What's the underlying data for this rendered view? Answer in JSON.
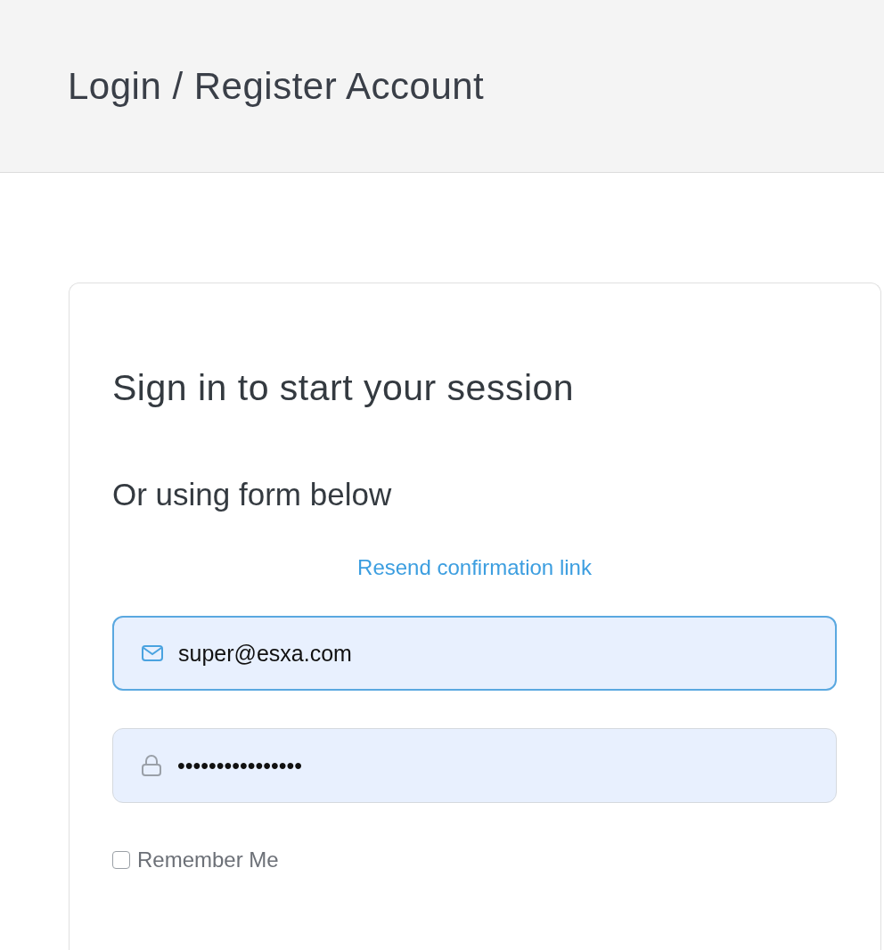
{
  "header": {
    "title": "Login / Register Account"
  },
  "card": {
    "title": "Sign in to start your session",
    "subtitle": "Or using form below",
    "resend_link": "Resend confirmation link",
    "fields": [
      {
        "kind": "email",
        "value": "super@esxa.com",
        "focused": true
      },
      {
        "kind": "password",
        "value": "••••••••••••••••",
        "focused": false
      }
    ],
    "remember": {
      "label": "Remember Me",
      "checked": false
    }
  }
}
